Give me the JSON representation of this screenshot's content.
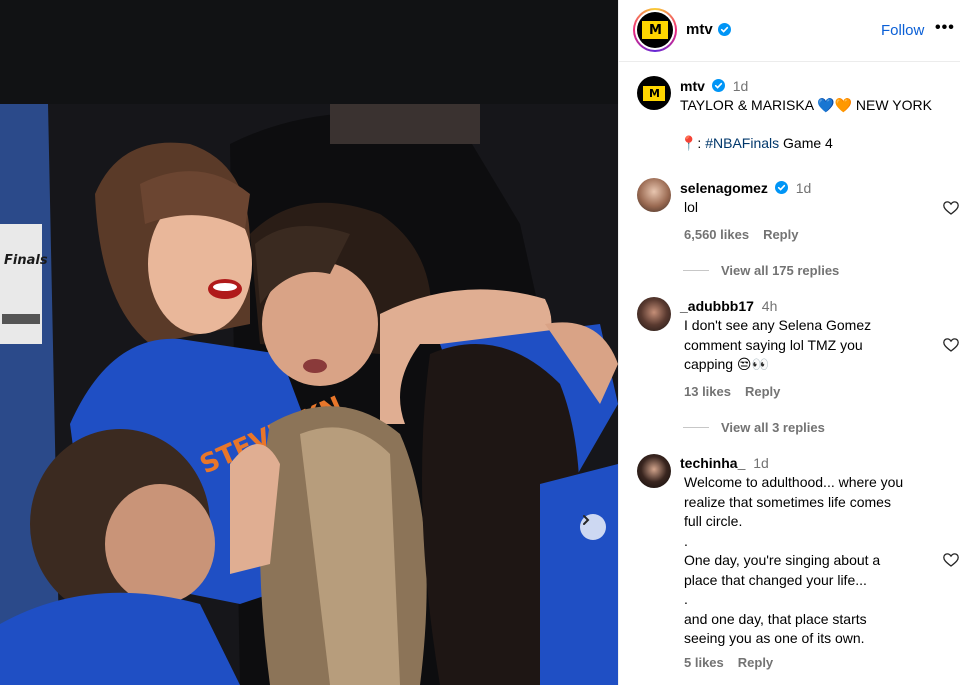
{
  "post": {
    "username": "mtv",
    "follow_label": "Follow",
    "more_label": "•••",
    "logo_text": "M"
  },
  "caption": {
    "username": "mtv",
    "time": "1d",
    "line1": "TAYLOR & MARISKA 💙🧡 NEW YORK",
    "pin": "📍: ",
    "hashtag": "#NBAFinals",
    "rest": " Game 4"
  },
  "photo": {
    "shirt_text": "STEVIE KN",
    "badge_text": "Finals"
  },
  "comments": [
    {
      "username": "selenagomez",
      "time": "1d",
      "verified": true,
      "text": "lol",
      "likes": "6,560 likes",
      "reply": "Reply",
      "view_replies": "View all 175 replies"
    },
    {
      "username": "_adubbb17",
      "time": "4h",
      "verified": false,
      "lines": [
        "I don't see any Selena Gomez",
        "comment saying lol TMZ you",
        "capping 😒👀"
      ],
      "likes": "13 likes",
      "reply": "Reply",
      "view_replies": "View all 3 replies"
    },
    {
      "username": "techinha_",
      "time": "1d",
      "verified": false,
      "lines": [
        "Welcome to adulthood... where you",
        "realize that sometimes life comes",
        "full circle.",
        ".",
        "One day, you're singing about a",
        "place that changed your life...",
        ".",
        "and one day, that place starts",
        "seeing you as one of its own."
      ],
      "likes": "5 likes",
      "reply": "Reply"
    }
  ],
  "colors": {
    "link": "#0a5fd6",
    "verified": "#0095f6",
    "muted": "#737373",
    "hashtag": "#00376b",
    "shirt_blue": "#1f4fc4",
    "shirt_orange": "#e8762a"
  },
  "icons": [
    "verified-badge-icon",
    "heart-icon",
    "chevron-right-icon",
    "more-dots-icon",
    "location-pin-icon"
  ]
}
